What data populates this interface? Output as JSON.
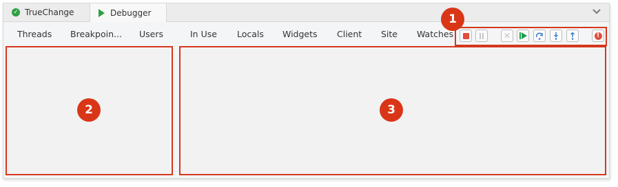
{
  "window_tabs": [
    {
      "label": "TrueChange",
      "icon": "check-circle-icon"
    },
    {
      "label": "Debugger",
      "icon": "play-icon"
    }
  ],
  "overflow_icon": "chevron-down-icon",
  "nav_tabs": [
    "Threads",
    "Breakpoin...",
    "Users",
    "In Use",
    "Locals",
    "Widgets",
    "Client",
    "Site",
    "Watches"
  ],
  "toolbar": {
    "buttons": [
      {
        "name": "stop",
        "icon": "stop-icon",
        "enabled": true,
        "color": "#e04e3c"
      },
      {
        "name": "pause",
        "icon": "pause-icon",
        "enabled": false
      },
      {
        "name": "abort",
        "icon": "close-icon",
        "enabled": false
      },
      {
        "name": "resume",
        "icon": "resume-icon",
        "enabled": true,
        "color": "#1b9e4b"
      },
      {
        "name": "step-over",
        "icon": "step-over-icon",
        "enabled": true
      },
      {
        "name": "step-into",
        "icon": "step-into-icon",
        "enabled": true
      },
      {
        "name": "step-out",
        "icon": "step-out-icon",
        "enabled": true
      },
      {
        "name": "error",
        "icon": "error-icon",
        "enabled": true,
        "color": "#e04e3c"
      }
    ]
  },
  "callouts": [
    "1",
    "2",
    "3"
  ],
  "colors": {
    "callout": "#d93617",
    "accent_green": "#2ea043"
  }
}
